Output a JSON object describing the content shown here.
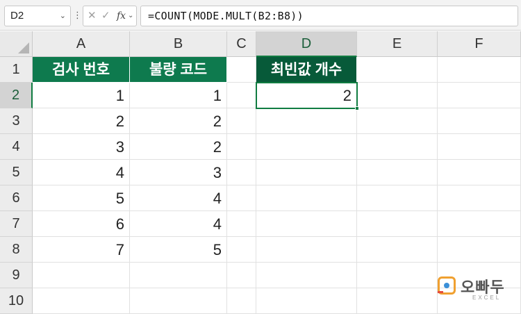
{
  "formula_bar": {
    "name_box": "D2",
    "fx_label": "fx",
    "formula": "=COUNT(MODE.MULT(B2:B8))"
  },
  "columns": [
    "A",
    "B",
    "C",
    "D",
    "E",
    "F"
  ],
  "rows": [
    "1",
    "2",
    "3",
    "4",
    "5",
    "6",
    "7",
    "8",
    "9",
    "10"
  ],
  "cells": {
    "A1": "검사 번호",
    "B1": "불량 코드",
    "D1": "최빈값 개수",
    "D2": "2",
    "A2": "1",
    "B2": "1",
    "A3": "2",
    "B3": "2",
    "A4": "3",
    "B4": "2",
    "A5": "4",
    "B5": "3",
    "A6": "5",
    "B6": "4",
    "A7": "6",
    "B7": "4",
    "A8": "7",
    "B8": "5"
  },
  "selection": {
    "cell": "D2",
    "column": "D",
    "row": "2"
  },
  "colors": {
    "header_fill": "#0e7a4e",
    "header_fill_dark": "#075a39",
    "selection": "#107c41"
  },
  "logo": {
    "name": "오빠두",
    "sub": "EXCEL"
  }
}
